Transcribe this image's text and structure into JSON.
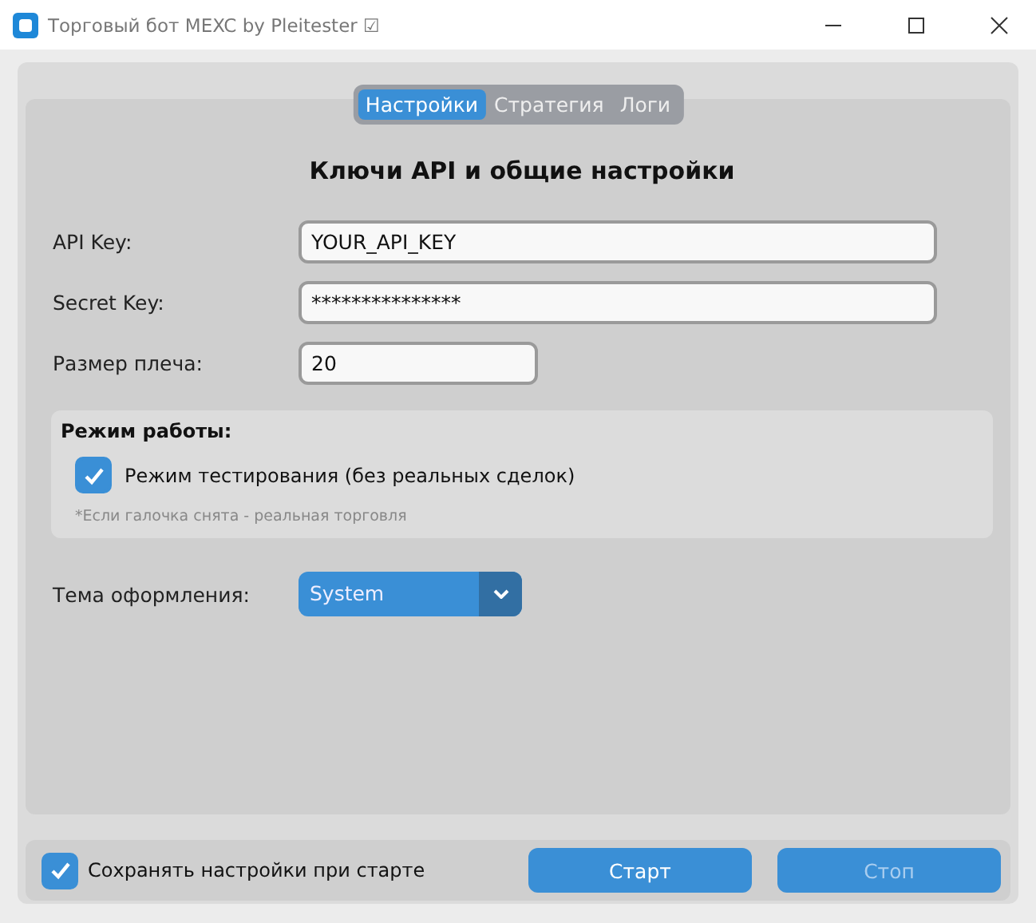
{
  "window": {
    "title": "Торговый бот MEXC by Pleitester ☑"
  },
  "tabs": [
    {
      "label": "Настройки",
      "selected": true
    },
    {
      "label": "Стратегия",
      "selected": false
    },
    {
      "label": "Логи",
      "selected": false
    }
  ],
  "heading": "Ключи API и общие настройки",
  "fields": [
    {
      "label": "API Key:",
      "value": "YOUR_API_KEY",
      "kind": "wide"
    },
    {
      "label": "Secret Key:",
      "value": "***************",
      "kind": "wide"
    },
    {
      "label": "Размер плеча:",
      "value": "20",
      "kind": "short"
    }
  ],
  "mode_group": {
    "title": "Режим работы:",
    "checkbox": {
      "label": "Режим тестирования (без реальных сделок)",
      "checked": true
    },
    "note": "*Если галочка снята - реальная торговля"
  },
  "theme": {
    "label": "Тема оформления:",
    "value": "System"
  },
  "footer": {
    "checkbox": {
      "label": "Сохранять настройки при старте",
      "checked": true
    },
    "buttons": [
      {
        "label": "Старт",
        "disabled": false
      },
      {
        "label": "Стоп",
        "disabled": true
      }
    ]
  }
}
